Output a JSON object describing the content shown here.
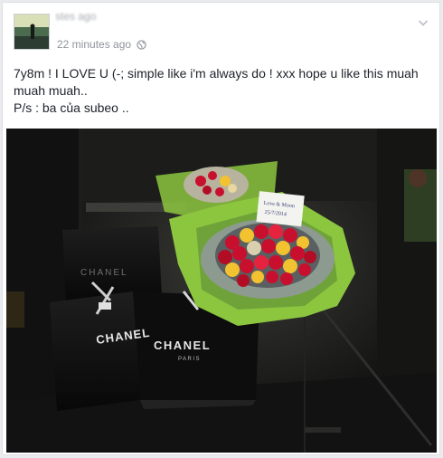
{
  "post": {
    "header_partial": "stes ago",
    "timestamp": "22 minutes ago",
    "privacy_icon": "globe-icon",
    "menu_icon": "chevron-down-icon",
    "text_line1": "7y8m ! I LOVE U (-; simple like i'm always do ! xxx hope u like this muah muah muah..",
    "text_line2": "P/s : ba của subeo .."
  },
  "photo": {
    "bag_brand": "CHANEL",
    "bag_sub": "PARIS",
    "card_line1": "Love & Moon",
    "card_line2": "25/7/2014"
  },
  "colors": {
    "text": "#1d2129",
    "meta": "#90949c",
    "wrap_green": "#8cc63f",
    "rose_red": "#c8102e",
    "rose_yellow": "#f2c230"
  }
}
